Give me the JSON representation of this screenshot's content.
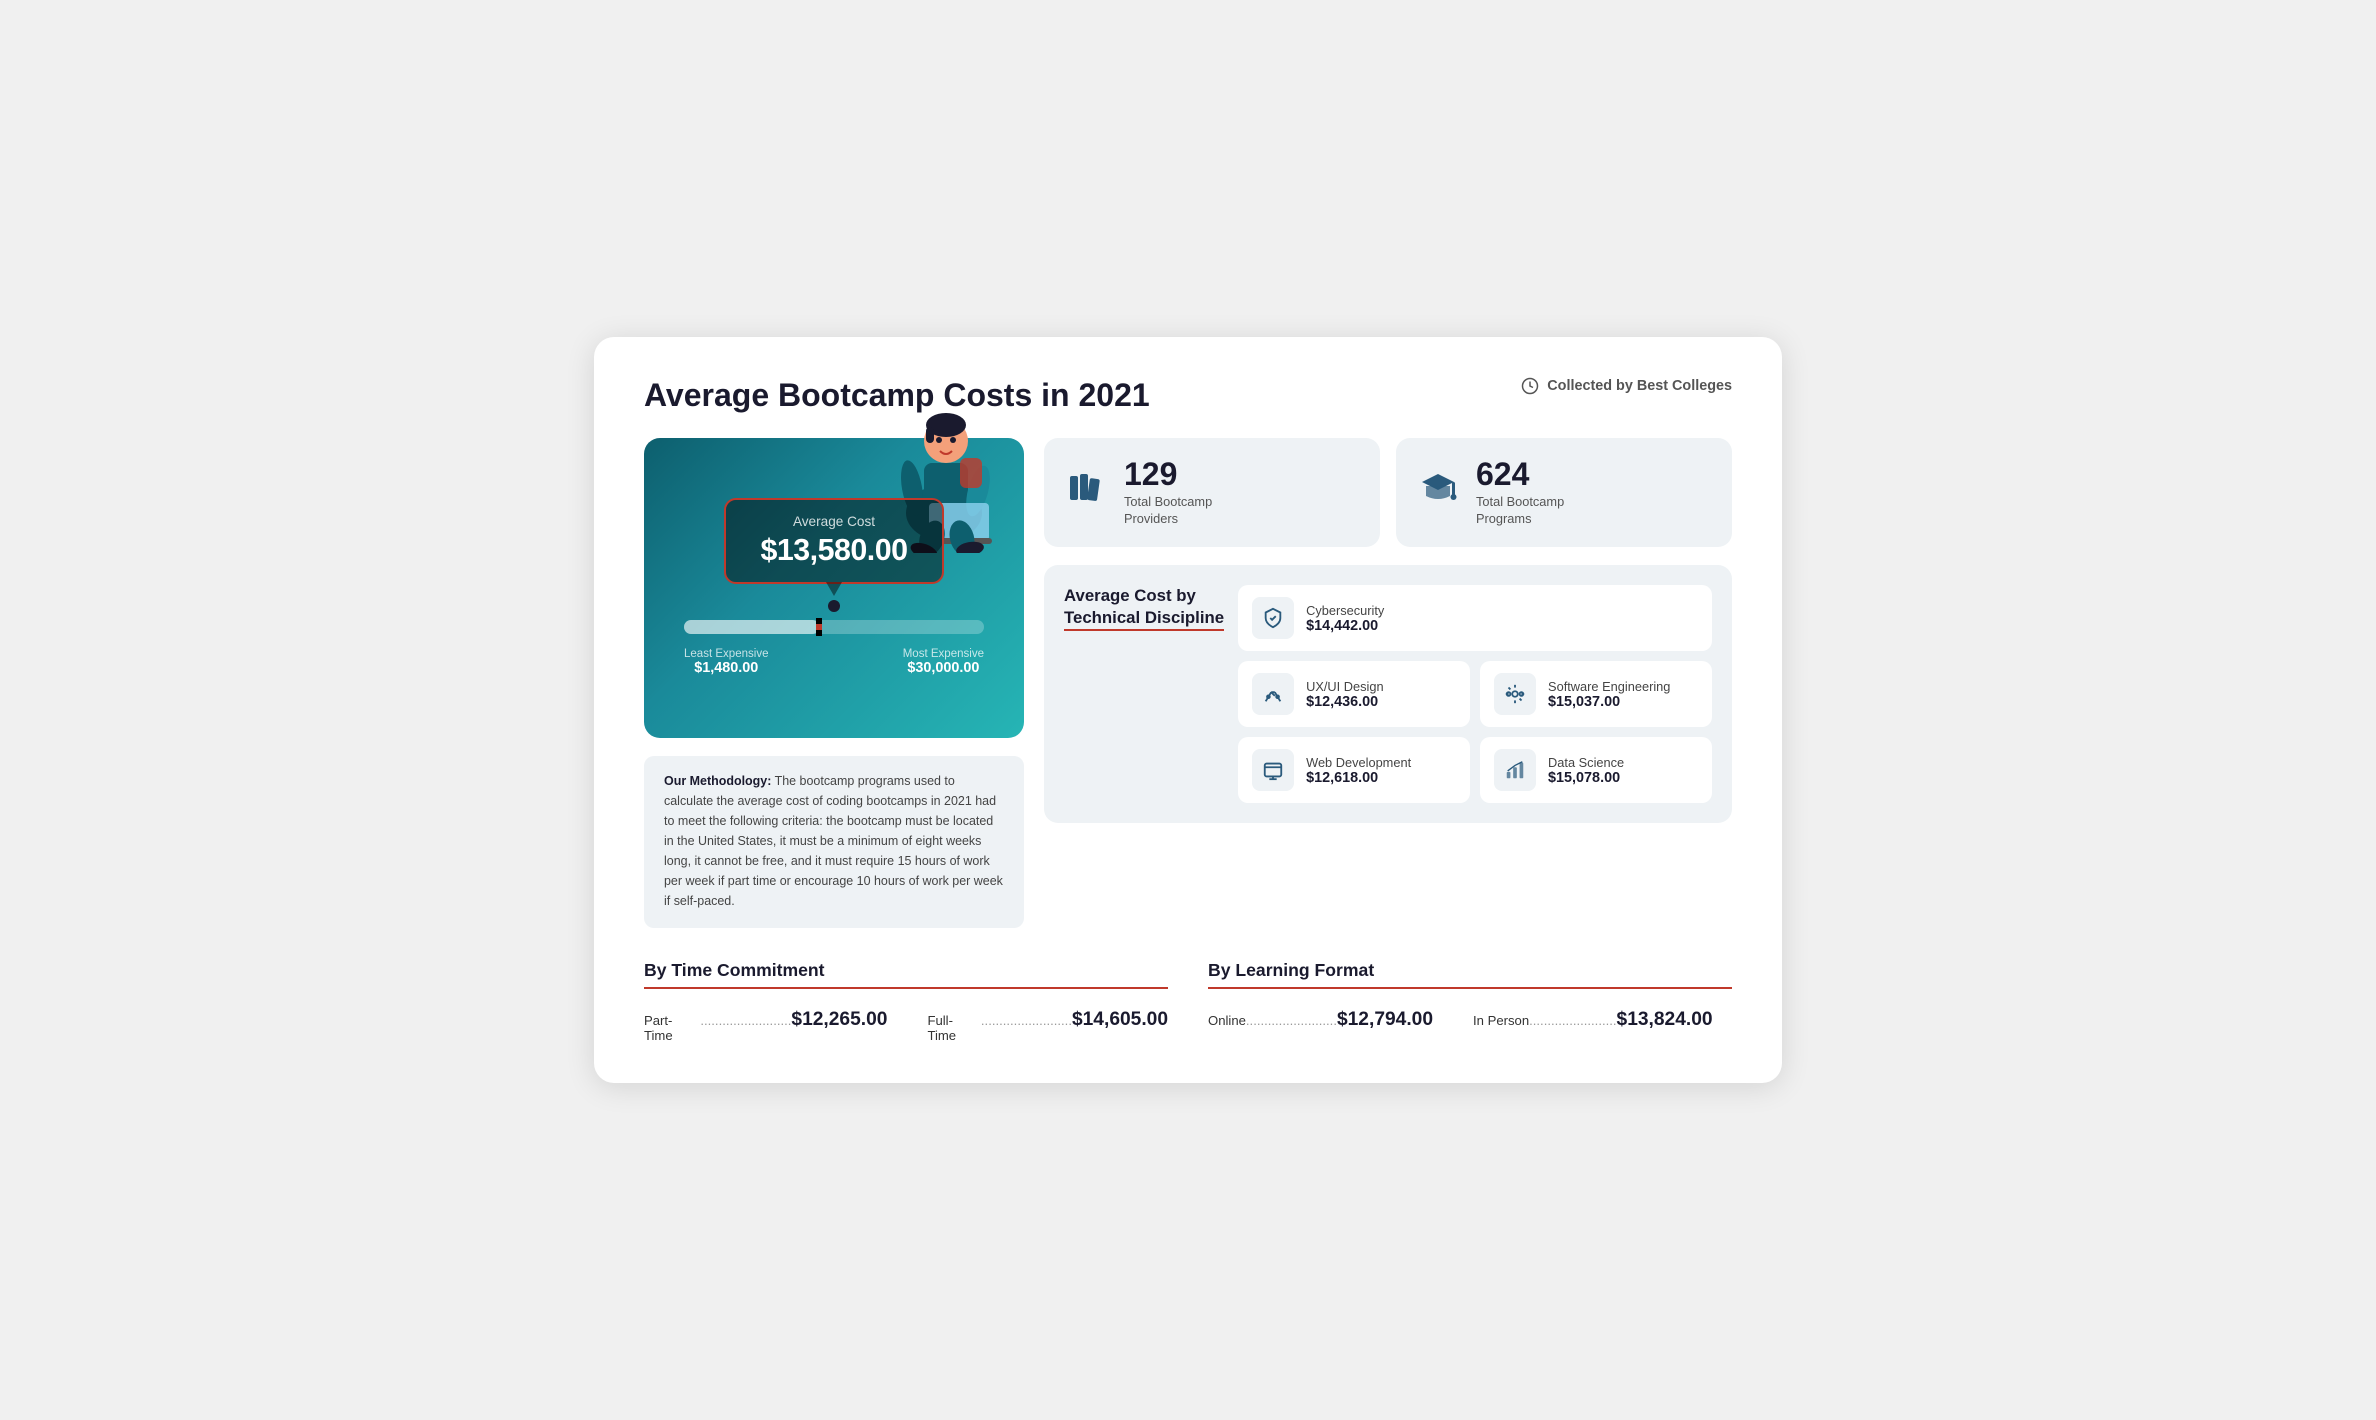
{
  "header": {
    "title": "Average Bootcamp Costs in 2021",
    "collected_by": "Collected by Best Colleges"
  },
  "gauge": {
    "avg_label": "Average Cost",
    "avg_value": "$13,580.00",
    "least_label": "Least Expensive",
    "least_value": "$1,480.00",
    "most_label": "Most Expensive",
    "most_value": "$30,000.00"
  },
  "stats": {
    "providers": {
      "number": "129",
      "label": "Total Bootcamp\nProviders"
    },
    "programs": {
      "number": "624",
      "label": "Total Bootcamp\nPrograms"
    }
  },
  "discipline": {
    "title": "Average Cost by\nTechnical Discipline",
    "items": [
      {
        "name": "Cybersecurity",
        "cost": "$14,442.00",
        "icon": "shield"
      },
      {
        "name": "UX/UI Design",
        "cost": "$12,436.00",
        "icon": "design"
      },
      {
        "name": "Software Engineering",
        "cost": "$15,037.00",
        "icon": "engineering"
      },
      {
        "name": "Web Development",
        "cost": "$12,618.00",
        "icon": "web"
      },
      {
        "name": "Data Science",
        "cost": "$15,078.00",
        "icon": "data"
      }
    ]
  },
  "methodology": {
    "bold": "Our Methodology:",
    "text": " The bootcamp programs used to calculate the average cost of coding bootcamps in 2021 had to meet the following criteria: the bootcamp must be located in the United States, it must be a minimum of eight weeks long, it cannot be free, and it must require 15 hours of work per week if part time or encourage 10 hours of work per week if self-paced."
  },
  "time_commitment": {
    "title": "By Time Commitment",
    "items": [
      {
        "label": "Part-Time",
        "dots": ".........................",
        "value": "$12,265.00"
      },
      {
        "label": "Full-Time",
        "dots": ".........................",
        "value": "$14,605.00"
      }
    ]
  },
  "learning_format": {
    "title": "By Learning Format",
    "items": [
      {
        "label": "Online",
        "dots": ".........................",
        "value": "$12,794.00"
      },
      {
        "label": "In Person",
        "dots": "........................",
        "value": "$13,824.00"
      }
    ]
  }
}
